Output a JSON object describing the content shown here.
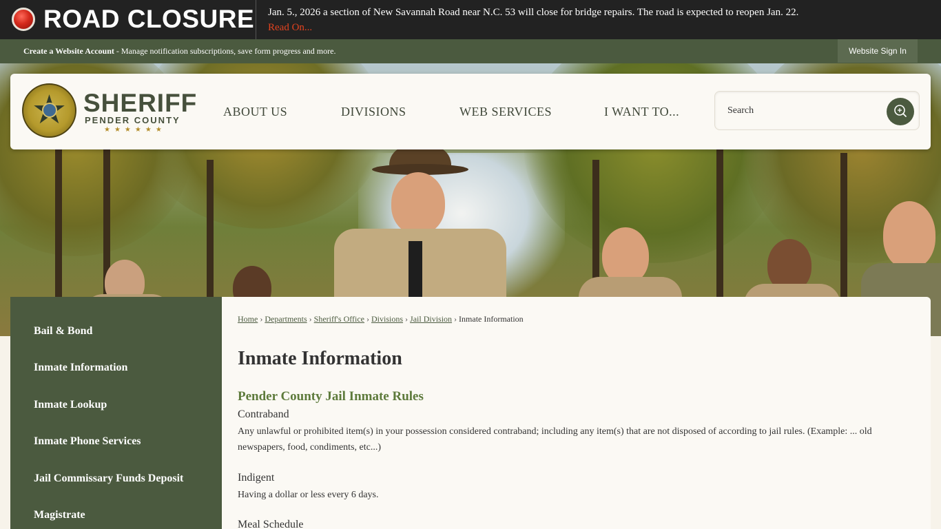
{
  "alert": {
    "title": "ROAD CLOSURE",
    "text": "Jan. 5., 2026 a section of New Savannah Road near N.C. 53 will close for bridge repairs. The road is expected to reopen Jan. 22.",
    "link": "Read On..."
  },
  "account_bar": {
    "create_label": "Create a Website Account",
    "create_desc": " - Manage notification subscriptions, save form progress and more.",
    "signin": "Website Sign In"
  },
  "logo": {
    "title": "SHERIFF",
    "subtitle": "PENDER COUNTY",
    "stars": "★★★★★★"
  },
  "nav": [
    "ABOUT US",
    "DIVISIONS",
    "WEB SERVICES",
    "I WANT TO..."
  ],
  "search": {
    "placeholder": "Search"
  },
  "sidebar": {
    "items": [
      "Bail & Bond",
      "Inmate Information",
      "Inmate Lookup",
      "Inmate Phone Services",
      "Jail Commissary Funds Deposit",
      "Magistrate"
    ]
  },
  "breadcrumb": {
    "links": [
      "Home",
      "Departments",
      "Sheriff's Office",
      "Divisions",
      "Jail Division"
    ],
    "separator": "›",
    "current": "Inmate Information"
  },
  "content": {
    "title": "Inmate Information",
    "section_heading": "Pender County Jail Inmate Rules",
    "sections": [
      {
        "term": "Contraband",
        "text": "Any unlawful or prohibited item(s) in your possession considered contraband; including any item(s) that are not disposed of according to jail rules. (Example: ... old newspapers, food, condiments, etc...)"
      },
      {
        "term": "Indigent",
        "text": "Having a dollar or less every 6 days."
      },
      {
        "term": "Meal Schedule",
        "text": ""
      }
    ]
  },
  "colors": {
    "alert_bg": "#222222",
    "alert_link": "#e2431f",
    "brand_green": "#4b5a3f",
    "heading_green": "#5d7a3b",
    "page_bg": "#fbf9f4"
  },
  "icons": {
    "alert": "red-alert-dot-icon",
    "search": "search-magnifier-icon",
    "badge": "sheriff-star-badge-icon"
  }
}
